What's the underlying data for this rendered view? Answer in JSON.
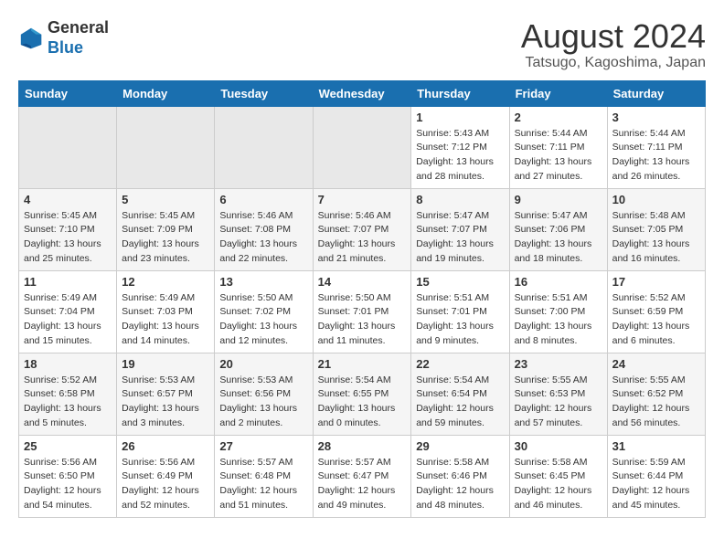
{
  "header": {
    "logo_general": "General",
    "logo_blue": "Blue",
    "month_title": "August 2024",
    "location": "Tatsugo, Kagoshima, Japan"
  },
  "days_of_week": [
    "Sunday",
    "Monday",
    "Tuesday",
    "Wednesday",
    "Thursday",
    "Friday",
    "Saturday"
  ],
  "weeks": [
    [
      {
        "day": "",
        "info": ""
      },
      {
        "day": "",
        "info": ""
      },
      {
        "day": "",
        "info": ""
      },
      {
        "day": "",
        "info": ""
      },
      {
        "day": "1",
        "info": "Sunrise: 5:43 AM\nSunset: 7:12 PM\nDaylight: 13 hours\nand 28 minutes."
      },
      {
        "day": "2",
        "info": "Sunrise: 5:44 AM\nSunset: 7:11 PM\nDaylight: 13 hours\nand 27 minutes."
      },
      {
        "day": "3",
        "info": "Sunrise: 5:44 AM\nSunset: 7:11 PM\nDaylight: 13 hours\nand 26 minutes."
      }
    ],
    [
      {
        "day": "4",
        "info": "Sunrise: 5:45 AM\nSunset: 7:10 PM\nDaylight: 13 hours\nand 25 minutes."
      },
      {
        "day": "5",
        "info": "Sunrise: 5:45 AM\nSunset: 7:09 PM\nDaylight: 13 hours\nand 23 minutes."
      },
      {
        "day": "6",
        "info": "Sunrise: 5:46 AM\nSunset: 7:08 PM\nDaylight: 13 hours\nand 22 minutes."
      },
      {
        "day": "7",
        "info": "Sunrise: 5:46 AM\nSunset: 7:07 PM\nDaylight: 13 hours\nand 21 minutes."
      },
      {
        "day": "8",
        "info": "Sunrise: 5:47 AM\nSunset: 7:07 PM\nDaylight: 13 hours\nand 19 minutes."
      },
      {
        "day": "9",
        "info": "Sunrise: 5:47 AM\nSunset: 7:06 PM\nDaylight: 13 hours\nand 18 minutes."
      },
      {
        "day": "10",
        "info": "Sunrise: 5:48 AM\nSunset: 7:05 PM\nDaylight: 13 hours\nand 16 minutes."
      }
    ],
    [
      {
        "day": "11",
        "info": "Sunrise: 5:49 AM\nSunset: 7:04 PM\nDaylight: 13 hours\nand 15 minutes."
      },
      {
        "day": "12",
        "info": "Sunrise: 5:49 AM\nSunset: 7:03 PM\nDaylight: 13 hours\nand 14 minutes."
      },
      {
        "day": "13",
        "info": "Sunrise: 5:50 AM\nSunset: 7:02 PM\nDaylight: 13 hours\nand 12 minutes."
      },
      {
        "day": "14",
        "info": "Sunrise: 5:50 AM\nSunset: 7:01 PM\nDaylight: 13 hours\nand 11 minutes."
      },
      {
        "day": "15",
        "info": "Sunrise: 5:51 AM\nSunset: 7:01 PM\nDaylight: 13 hours\nand 9 minutes."
      },
      {
        "day": "16",
        "info": "Sunrise: 5:51 AM\nSunset: 7:00 PM\nDaylight: 13 hours\nand 8 minutes."
      },
      {
        "day": "17",
        "info": "Sunrise: 5:52 AM\nSunset: 6:59 PM\nDaylight: 13 hours\nand 6 minutes."
      }
    ],
    [
      {
        "day": "18",
        "info": "Sunrise: 5:52 AM\nSunset: 6:58 PM\nDaylight: 13 hours\nand 5 minutes."
      },
      {
        "day": "19",
        "info": "Sunrise: 5:53 AM\nSunset: 6:57 PM\nDaylight: 13 hours\nand 3 minutes."
      },
      {
        "day": "20",
        "info": "Sunrise: 5:53 AM\nSunset: 6:56 PM\nDaylight: 13 hours\nand 2 minutes."
      },
      {
        "day": "21",
        "info": "Sunrise: 5:54 AM\nSunset: 6:55 PM\nDaylight: 13 hours\nand 0 minutes."
      },
      {
        "day": "22",
        "info": "Sunrise: 5:54 AM\nSunset: 6:54 PM\nDaylight: 12 hours\nand 59 minutes."
      },
      {
        "day": "23",
        "info": "Sunrise: 5:55 AM\nSunset: 6:53 PM\nDaylight: 12 hours\nand 57 minutes."
      },
      {
        "day": "24",
        "info": "Sunrise: 5:55 AM\nSunset: 6:52 PM\nDaylight: 12 hours\nand 56 minutes."
      }
    ],
    [
      {
        "day": "25",
        "info": "Sunrise: 5:56 AM\nSunset: 6:50 PM\nDaylight: 12 hours\nand 54 minutes."
      },
      {
        "day": "26",
        "info": "Sunrise: 5:56 AM\nSunset: 6:49 PM\nDaylight: 12 hours\nand 52 minutes."
      },
      {
        "day": "27",
        "info": "Sunrise: 5:57 AM\nSunset: 6:48 PM\nDaylight: 12 hours\nand 51 minutes."
      },
      {
        "day": "28",
        "info": "Sunrise: 5:57 AM\nSunset: 6:47 PM\nDaylight: 12 hours\nand 49 minutes."
      },
      {
        "day": "29",
        "info": "Sunrise: 5:58 AM\nSunset: 6:46 PM\nDaylight: 12 hours\nand 48 minutes."
      },
      {
        "day": "30",
        "info": "Sunrise: 5:58 AM\nSunset: 6:45 PM\nDaylight: 12 hours\nand 46 minutes."
      },
      {
        "day": "31",
        "info": "Sunrise: 5:59 AM\nSunset: 6:44 PM\nDaylight: 12 hours\nand 45 minutes."
      }
    ]
  ]
}
